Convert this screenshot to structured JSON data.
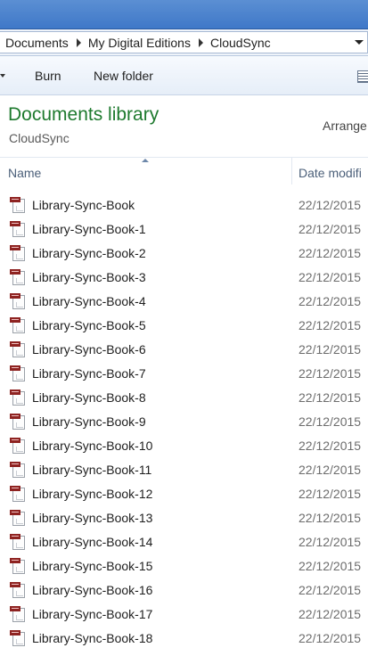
{
  "address": {
    "crumbs": [
      "Documents",
      "My Digital Editions",
      "CloudSync"
    ]
  },
  "toolbar": {
    "burn_label": "Burn",
    "new_folder_label": "New folder"
  },
  "library": {
    "title": "Documents library",
    "subtitle": "CloudSync",
    "arrange_label": "Arrange"
  },
  "columns": {
    "name": "Name",
    "date": "Date modifi"
  },
  "files": [
    {
      "name": "Library-Sync-Book",
      "date": "22/12/2015"
    },
    {
      "name": "Library-Sync-Book-1",
      "date": "22/12/2015"
    },
    {
      "name": "Library-Sync-Book-2",
      "date": "22/12/2015"
    },
    {
      "name": "Library-Sync-Book-3",
      "date": "22/12/2015"
    },
    {
      "name": "Library-Sync-Book-4",
      "date": "22/12/2015"
    },
    {
      "name": "Library-Sync-Book-5",
      "date": "22/12/2015"
    },
    {
      "name": "Library-Sync-Book-6",
      "date": "22/12/2015"
    },
    {
      "name": "Library-Sync-Book-7",
      "date": "22/12/2015"
    },
    {
      "name": "Library-Sync-Book-8",
      "date": "22/12/2015"
    },
    {
      "name": "Library-Sync-Book-9",
      "date": "22/12/2015"
    },
    {
      "name": "Library-Sync-Book-10",
      "date": "22/12/2015"
    },
    {
      "name": "Library-Sync-Book-11",
      "date": "22/12/2015"
    },
    {
      "name": "Library-Sync-Book-12",
      "date": "22/12/2015"
    },
    {
      "name": "Library-Sync-Book-13",
      "date": "22/12/2015"
    },
    {
      "name": "Library-Sync-Book-14",
      "date": "22/12/2015"
    },
    {
      "name": "Library-Sync-Book-15",
      "date": "22/12/2015"
    },
    {
      "name": "Library-Sync-Book-16",
      "date": "22/12/2015"
    },
    {
      "name": "Library-Sync-Book-17",
      "date": "22/12/2015"
    },
    {
      "name": "Library-Sync-Book-18",
      "date": "22/12/2015"
    }
  ],
  "file_icon": "html-document-icon"
}
